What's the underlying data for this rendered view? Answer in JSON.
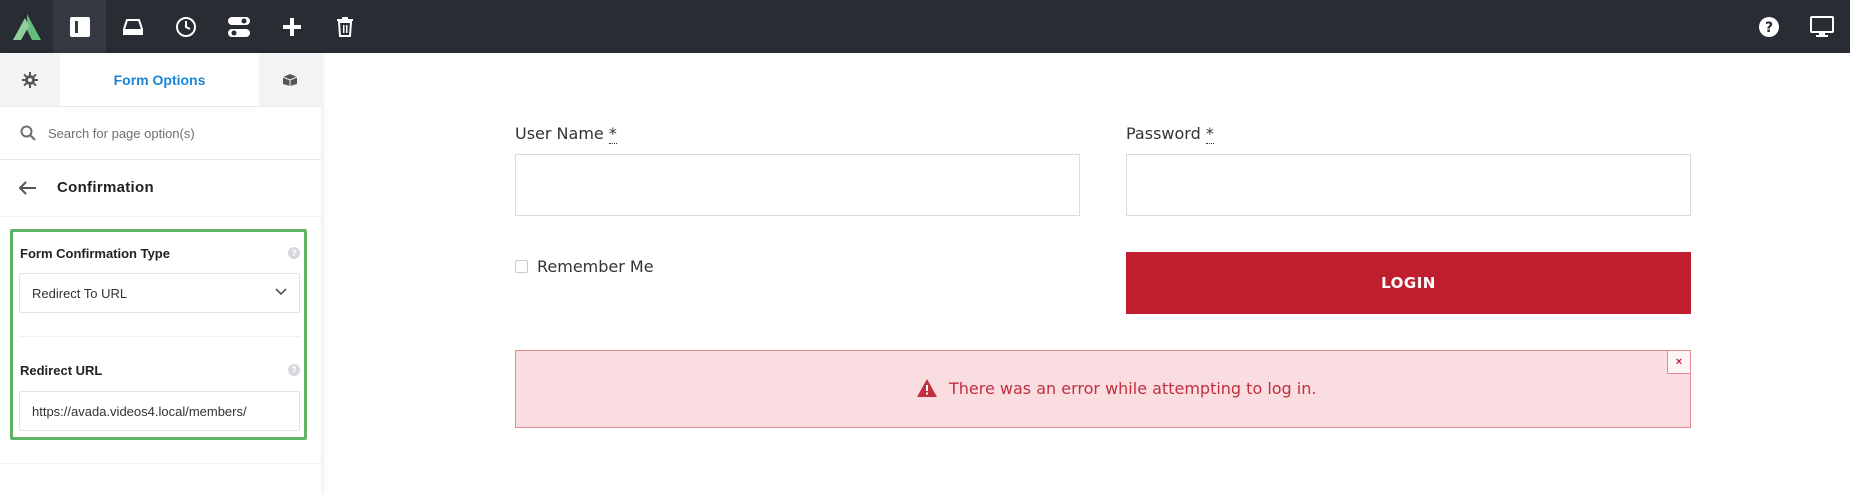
{
  "topbar": {
    "icons": [
      "avada-logo-icon",
      "sidebar-toggle-icon",
      "library-icon",
      "history-icon",
      "toggles-icon",
      "add-icon",
      "trash-icon",
      "help-icon",
      "preview-icon"
    ]
  },
  "sidebar": {
    "tabs": {
      "form_options_label": "Form Options"
    },
    "search_placeholder": "Search for page option(s)",
    "section_title": "Confirmation",
    "confirmation_type": {
      "label": "Form Confirmation Type",
      "value": "Redirect To URL"
    },
    "redirect_url": {
      "label": "Redirect URL",
      "value": "https://avada.videos4.local/members/"
    }
  },
  "form": {
    "username_label": "User Name",
    "password_label": "Password",
    "required_mark": "*",
    "remember_label": "Remember Me",
    "login_label": "LOGIN",
    "error_message": "There was an error while attempting to log in.",
    "error_close": "×"
  },
  "colors": {
    "topbar_bg": "#282c33",
    "accent_blue": "#1a85d6",
    "highlight_green": "#5fb466",
    "login_red": "#be1e2d",
    "error_bg": "#f9dde0"
  }
}
